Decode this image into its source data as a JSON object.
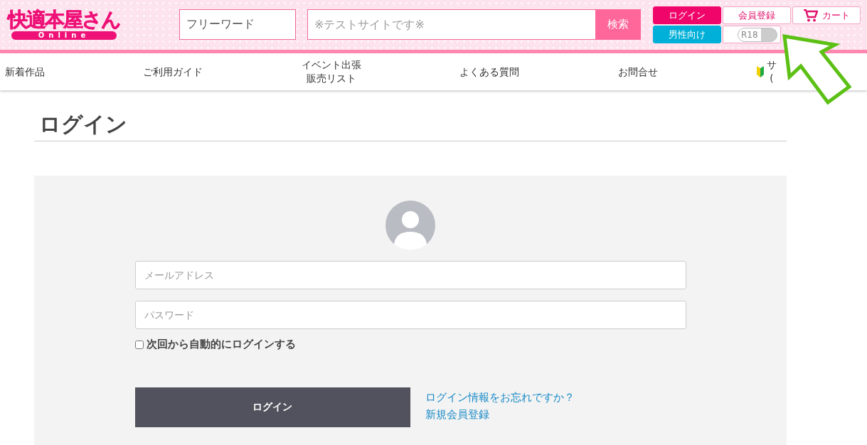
{
  "header": {
    "logo": {
      "title": "快適本屋さん",
      "subtitle": "Online"
    },
    "keyword_field": {
      "value": "フリーワード"
    },
    "search_field": {
      "placeholder": "※テストサイトです※"
    },
    "search_button": "検索",
    "login_button": "ログイン",
    "register_button": "会員登録",
    "cart_button": "カート",
    "audience_button": "男性向け",
    "r18_toggle": {
      "label": "R18",
      "on": false
    }
  },
  "nav": [
    {
      "kind": "text",
      "lines": [
        "新着作品"
      ]
    },
    {
      "kind": "text",
      "lines": [
        "ご利用ガイド"
      ]
    },
    {
      "kind": "text",
      "lines": [
        "イベント出張",
        "販売リスト"
      ]
    },
    {
      "kind": "text",
      "lines": [
        "よくある質問"
      ]
    },
    {
      "kind": "text",
      "lines": [
        "お問合せ"
      ]
    },
    {
      "kind": "beginner",
      "lines": [
        "サ",
        "("
      ]
    }
  ],
  "page_title": "ログイン",
  "form": {
    "email": {
      "placeholder": "メールアドレス"
    },
    "password": {
      "placeholder": "パスワード"
    },
    "remember": {
      "label": "次回から自動的にログインする",
      "checked": false
    },
    "submit": "ログイン",
    "links": [
      "ログイン情報をお忘れですか？",
      "新規会員登録"
    ]
  }
}
